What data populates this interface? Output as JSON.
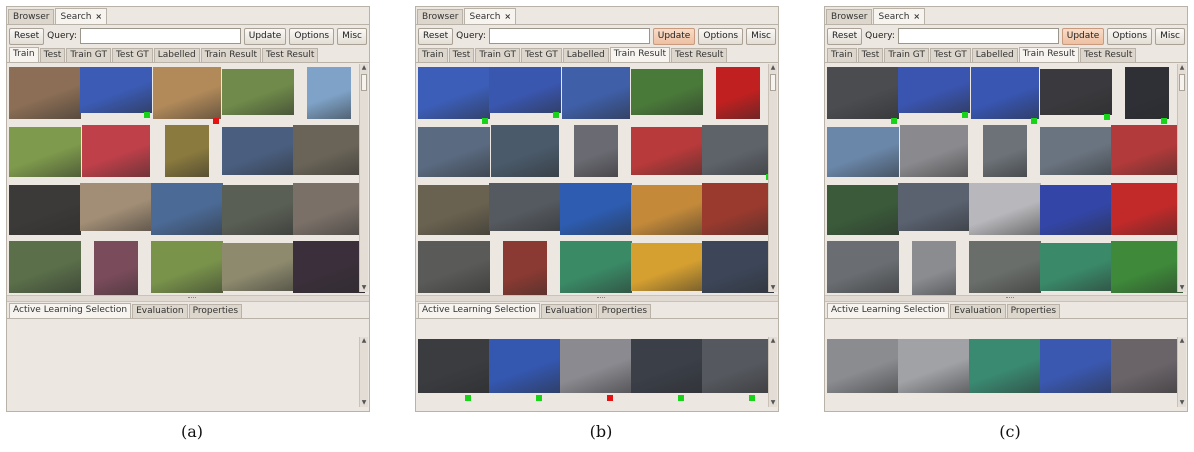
{
  "window_tabs": [
    {
      "label": "Browser",
      "active": false
    },
    {
      "label": "Search",
      "active": true,
      "close": "×"
    }
  ],
  "toolbar": {
    "reset": "Reset",
    "query_label": "Query:",
    "query_value": "",
    "update": "Update",
    "options": "Options",
    "misc": "Misc"
  },
  "top_tabs": [
    "Train",
    "Test",
    "Train GT",
    "Test GT",
    "Labelled",
    "Train Result",
    "Test Result"
  ],
  "bottom_tabs": [
    "Active Learning Selection",
    "Evaluation",
    "Properties"
  ],
  "scroll": {
    "up": "▲",
    "down": "▼"
  },
  "panels": [
    {
      "id": "a",
      "caption": "(a)",
      "active_tab": 0,
      "update_highlighted": false,
      "rows": [
        [
          {
            "c": "#8b6e55",
            "m": ""
          },
          {
            "c": "#3b5bb4",
            "m": "green"
          },
          {
            "c": "#b28a5a",
            "m": "red"
          },
          {
            "c": "#6f8a4a",
            "m": ""
          },
          {
            "c": "#7fa3c8",
            "m": ""
          }
        ],
        [
          {
            "c": "#7e9a4c",
            "m": ""
          },
          {
            "c": "#c0404a",
            "m": ""
          },
          {
            "c": "#8a7a3e",
            "m": ""
          },
          {
            "c": "#4a5f80",
            "m": ""
          },
          {
            "c": "#6a6458",
            "m": ""
          }
        ],
        [
          {
            "c": "#3c3a38",
            "m": ""
          },
          {
            "c": "#a28e76",
            "m": ""
          },
          {
            "c": "#4b6a96",
            "m": ""
          },
          {
            "c": "#5a5f55",
            "m": ""
          },
          {
            "c": "#7a7068",
            "m": ""
          }
        ],
        [
          {
            "c": "#5a6f4a",
            "m": ""
          },
          {
            "c": "#7a4b5a",
            "m": ""
          },
          {
            "c": "#79934b",
            "m": ""
          },
          {
            "c": "#8d8a6e",
            "m": ""
          },
          {
            "c": "#3a2f3a",
            "m": ""
          }
        ]
      ],
      "selection": []
    },
    {
      "id": "b",
      "caption": "(b)",
      "active_tab": 5,
      "update_highlighted": true,
      "rows": [
        [
          {
            "c": "#3c5eb8",
            "m": "green"
          },
          {
            "c": "#3a57b0",
            "m": "green"
          },
          {
            "c": "#3f5fa8",
            "m": ""
          },
          {
            "c": "#4a7a3a",
            "m": ""
          },
          {
            "c": "#c02020",
            "m": ""
          }
        ],
        [
          {
            "c": "#5a6a80",
            "m": ""
          },
          {
            "c": "#4a5a6a",
            "m": ""
          },
          {
            "c": "#6a6a72",
            "m": ""
          },
          {
            "c": "#b83a3a",
            "m": ""
          },
          {
            "c": "#5e636a",
            "m": "green"
          }
        ],
        [
          {
            "c": "#6a6250",
            "m": ""
          },
          {
            "c": "#555a60",
            "m": ""
          },
          {
            "c": "#2d5cb0",
            "m": ""
          },
          {
            "c": "#c48a3a",
            "m": ""
          },
          {
            "c": "#9a3a2e",
            "m": ""
          }
        ],
        [
          {
            "c": "#5a5a58",
            "m": ""
          },
          {
            "c": "#8a3a32",
            "m": ""
          },
          {
            "c": "#3a8a66",
            "m": ""
          },
          {
            "c": "#d6a030",
            "m": ""
          },
          {
            "c": "#3c4658",
            "m": ""
          }
        ]
      ],
      "selection": [
        {
          "c": "#3a3c40",
          "m": "green"
        },
        {
          "c": "#3457b0",
          "m": "green"
        },
        {
          "c": "#8a8a90",
          "m": "red"
        },
        {
          "c": "#3a3f48",
          "m": "green"
        },
        {
          "c": "#55585e",
          "m": "green"
        }
      ]
    },
    {
      "id": "c",
      "caption": "(c)",
      "active_tab": 5,
      "update_highlighted": true,
      "rows": [
        [
          {
            "c": "#4a4c50",
            "m": "green"
          },
          {
            "c": "#3a55b0",
            "m": "green"
          },
          {
            "c": "#3856b2",
            "m": "green"
          },
          {
            "c": "#3a3a3e",
            "m": "green"
          },
          {
            "c": "#2e3036",
            "m": "green"
          }
        ],
        [
          {
            "c": "#6a86a8",
            "m": ""
          },
          {
            "c": "#8a8a8e",
            "m": ""
          },
          {
            "c": "#6c7278",
            "m": ""
          },
          {
            "c": "#6a7480",
            "m": ""
          },
          {
            "c": "#b23a3a",
            "m": ""
          }
        ],
        [
          {
            "c": "#3a5a3a",
            "m": ""
          },
          {
            "c": "#5a6270",
            "m": ""
          },
          {
            "c": "#b8b8bc",
            "m": ""
          },
          {
            "c": "#3346a8",
            "m": ""
          },
          {
            "c": "#c22a2a",
            "m": ""
          }
        ],
        [
          {
            "c": "#6a6e72",
            "m": ""
          },
          {
            "c": "#8a8c90",
            "m": ""
          },
          {
            "c": "#6a6e6a",
            "m": ""
          },
          {
            "c": "#3a8a6a",
            "m": ""
          },
          {
            "c": "#3e8a3a",
            "m": ""
          }
        ]
      ],
      "selection": [
        {
          "c": "#8a8c90",
          "m": ""
        },
        {
          "c": "#a0a2a6",
          "m": ""
        },
        {
          "c": "#3a8a72",
          "m": ""
        },
        {
          "c": "#3a58b0",
          "m": ""
        },
        {
          "c": "#6a6468",
          "m": ""
        }
      ]
    }
  ]
}
